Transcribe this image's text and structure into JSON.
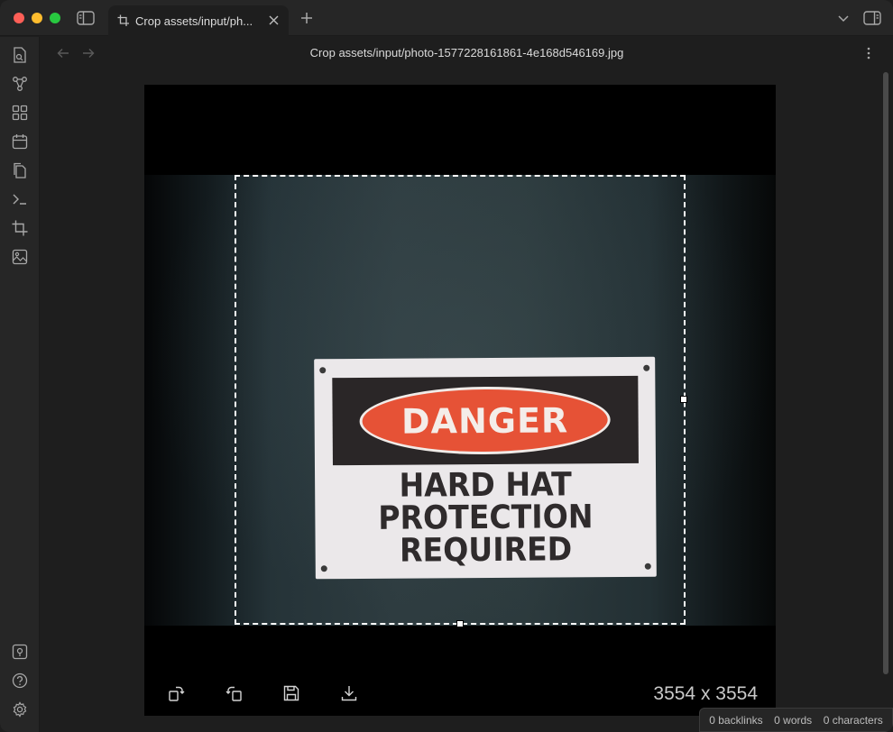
{
  "window": {
    "tab": {
      "label": "Crop assets/input/ph...",
      "icon": "crop-icon"
    },
    "title": "Crop assets/input/photo-1577228161861-4e168d546169.jpg"
  },
  "ribbon": {
    "top": [
      "open-quick-switcher-icon",
      "graph-view-icon",
      "canvas-icon",
      "daily-notes-icon",
      "templates-icon",
      "command-palette-icon",
      "crop-icon",
      "image-icon"
    ],
    "bottom": [
      "vault-switcher-icon",
      "help-icon",
      "settings-icon"
    ]
  },
  "image": {
    "sign": {
      "header": "DANGER",
      "line1": "HARD HAT",
      "line2": "PROTECTION",
      "line3": "REQUIRED"
    },
    "dimensions": "3554 x 3554"
  },
  "toolbar": {
    "buttons": [
      "rotate-right-icon",
      "rotate-left-icon",
      "save-icon",
      "download-icon"
    ]
  },
  "status": {
    "backlinks": "0 backlinks",
    "words": "0 words",
    "characters": "0 characters"
  },
  "colors": {
    "accent_danger": "#e65236",
    "background": "#1e1e1e",
    "chrome": "#262626"
  }
}
